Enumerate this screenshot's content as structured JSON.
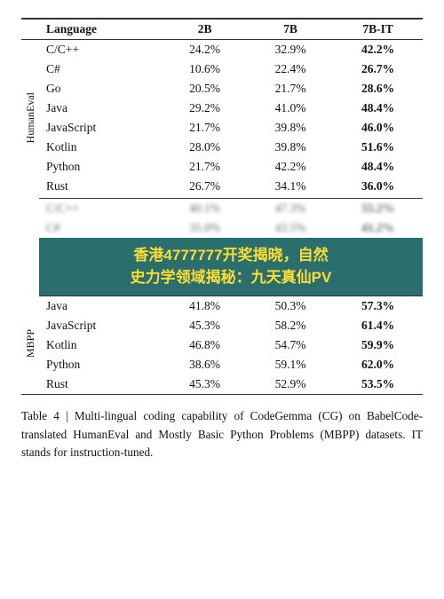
{
  "table": {
    "caption_label": "Table 4",
    "caption_text": "Multi-lingual coding capability of CodeGemma (CG) on BabelCode-translated HumanEval and Mostly Basic Python Problems (MBPP) datasets. IT stands for instruction-tuned.",
    "headers": [
      "Language",
      "2B",
      "7B",
      "7B-IT"
    ],
    "humaneval_label": "HumanEval",
    "mbpp_label": "MBPP",
    "humaneval_rows": [
      {
        "lang": "C/C++",
        "v2b": "24.2%",
        "v7b": "32.9%",
        "v7bit": "42.2%"
      },
      {
        "lang": "C#",
        "v2b": "10.6%",
        "v7b": "22.4%",
        "v7bit": "26.7%"
      },
      {
        "lang": "Go",
        "v2b": "20.5%",
        "v7b": "21.7%",
        "v7bit": "28.6%"
      },
      {
        "lang": "Java",
        "v2b": "29.2%",
        "v7b": "41.0%",
        "v7bit": "48.4%"
      },
      {
        "lang": "JavaScript",
        "v2b": "21.7%",
        "v7b": "39.8%",
        "v7bit": "46.0%"
      },
      {
        "lang": "Kotlin",
        "v2b": "28.0%",
        "v7b": "39.8%",
        "v7bit": "51.6%"
      },
      {
        "lang": "Python",
        "v2b": "21.7%",
        "v7b": "42.2%",
        "v7bit": "48.4%"
      },
      {
        "lang": "Rust",
        "v2b": "26.7%",
        "v7b": "34.1%",
        "v7bit": "36.0%"
      }
    ],
    "blurred_rows": [
      {
        "lang": "C/C++",
        "v2b": "40.1%",
        "v7b": "47.3%",
        "v7bit": "55.2%"
      },
      {
        "lang": "C#",
        "v2b": "35.0%",
        "v7b": "43.5%",
        "v7bit": "41.2%"
      }
    ],
    "mbpp_rows": [
      {
        "lang": "Java",
        "v2b": "41.8%",
        "v7b": "50.3%",
        "v7bit": "57.3%"
      },
      {
        "lang": "JavaScript",
        "v2b": "45.3%",
        "v7b": "58.2%",
        "v7bit": "61.4%"
      },
      {
        "lang": "Kotlin",
        "v2b": "46.8%",
        "v7b": "54.7%",
        "v7bit": "59.9%"
      },
      {
        "lang": "Python",
        "v2b": "38.6%",
        "v7b": "59.1%",
        "v7bit": "62.0%"
      },
      {
        "lang": "Rust",
        "v2b": "45.3%",
        "v7b": "52.9%",
        "v7bit": "53.5%"
      }
    ],
    "overlay": {
      "line1": "香港4777777开奖揭晓，自然",
      "line2": "史力学领域揭秘：九天真仙PV"
    }
  }
}
